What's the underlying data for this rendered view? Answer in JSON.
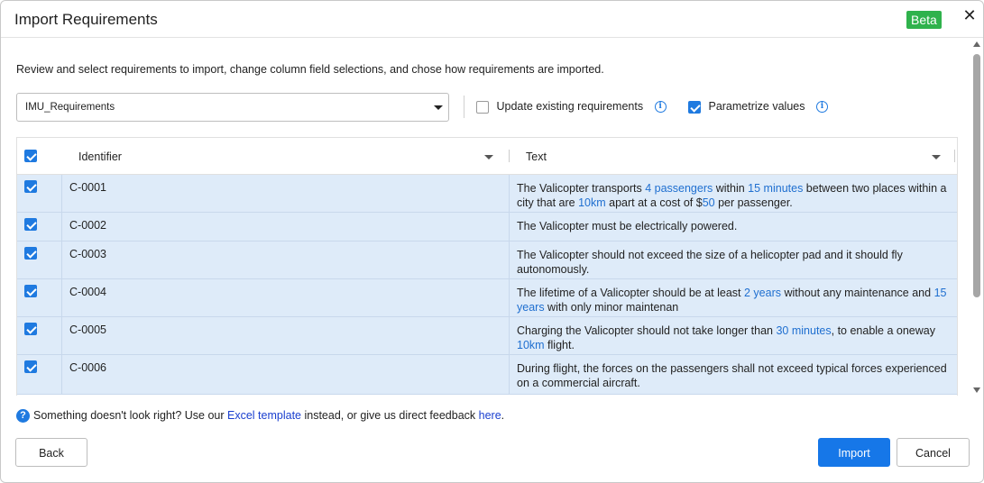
{
  "dialog": {
    "title": "Import Requirements",
    "badge": "Beta",
    "close_glyph": "✕",
    "intro": "Review and select requirements to import, change column field selections, and chose how requirements are imported."
  },
  "source_select": {
    "value": "IMU_Requirements"
  },
  "options": {
    "update_existing": {
      "label": "Update existing requirements",
      "checked": false
    },
    "parametrize": {
      "label": "Parametrize values",
      "checked": true
    },
    "info_glyph": "i"
  },
  "table": {
    "header_checked": true,
    "columns": [
      "Identifier",
      "Text"
    ],
    "rows": [
      {
        "id": "C-0001",
        "checked": true,
        "segments": [
          {
            "t": "The Valicopter transports "
          },
          {
            "t": "4 passengers",
            "h": true
          },
          {
            "t": " within "
          },
          {
            "t": "15 minutes",
            "h": true
          },
          {
            "t": " between two places within a city that are "
          },
          {
            "t": "10km",
            "h": true
          },
          {
            "t": " apart at a cost of $"
          },
          {
            "t": "50",
            "h": true
          },
          {
            "t": " per passenger."
          }
        ]
      },
      {
        "id": "C-0002",
        "checked": true,
        "segments": [
          {
            "t": "The Valicopter must be electrically powered."
          }
        ]
      },
      {
        "id": "C-0003",
        "checked": true,
        "segments": [
          {
            "t": "The Valicopter should not exceed the size of a helicopter pad and it should fly autonomously."
          }
        ]
      },
      {
        "id": "C-0004",
        "checked": true,
        "segments": [
          {
            "t": "The lifetime of a Valicopter should be at least "
          },
          {
            "t": "2 years",
            "h": true
          },
          {
            "t": " without any maintenance and "
          },
          {
            "t": "15 years",
            "h": true
          },
          {
            "t": " with only minor maintenan"
          }
        ]
      },
      {
        "id": "C-0005",
        "checked": true,
        "segments": [
          {
            "t": "Charging the Valicopter should not take longer than "
          },
          {
            "t": "30 minutes",
            "h": true
          },
          {
            "t": ", to enable a oneway "
          },
          {
            "t": "10km",
            "h": true
          },
          {
            "t": " flight."
          }
        ]
      },
      {
        "id": "C-0006",
        "checked": true,
        "segments": [
          {
            "t": "During flight, the forces on the passengers shall not exceed typical forces experienced on a commercial aircraft."
          }
        ]
      }
    ]
  },
  "feedback": {
    "icon_glyph": "?",
    "before": "Something doesn't look right? Use our ",
    "excel_link": "Excel template",
    "middle": " instead, or give us direct feedback ",
    "here_link": "here",
    "after": "."
  },
  "footer": {
    "back": "Back",
    "import": "Import",
    "cancel": "Cancel"
  },
  "colors": {
    "accent": "#1f7ae0",
    "row_selected": "#deebf9",
    "badge": "#2fb24c",
    "highlight_text": "#1f6fd0"
  }
}
